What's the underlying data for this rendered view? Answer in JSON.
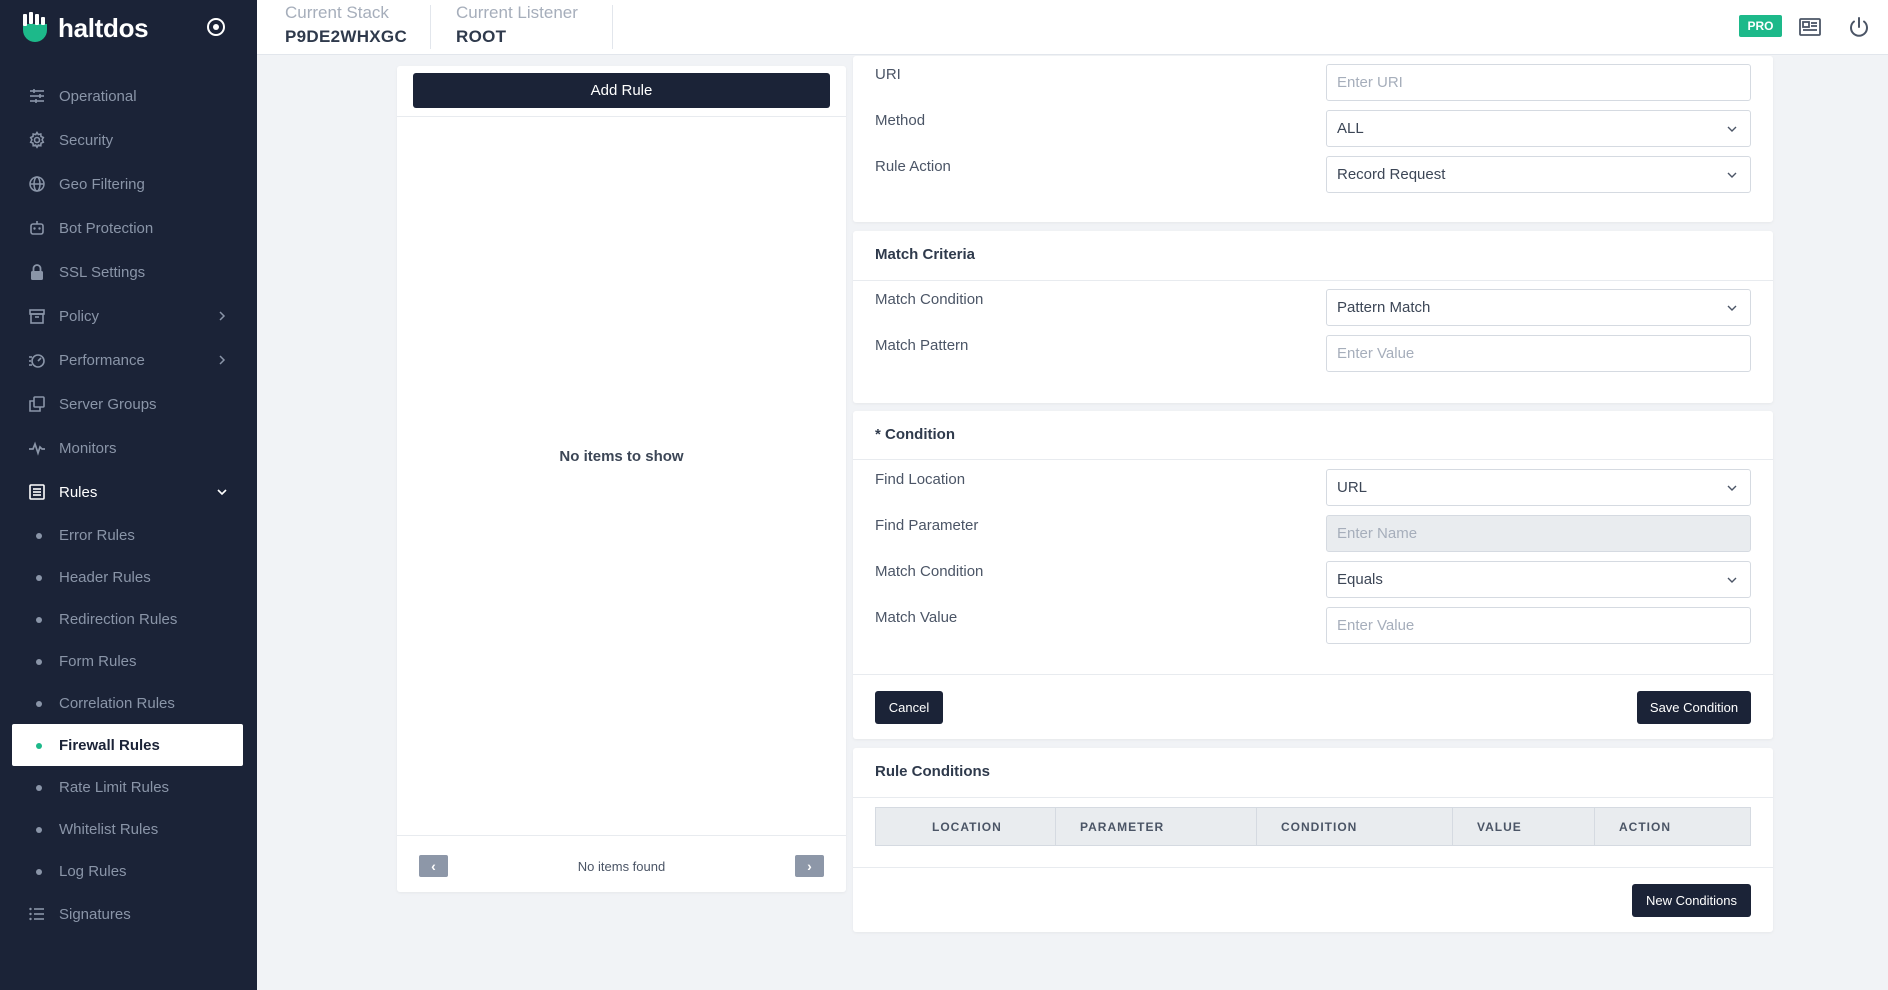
{
  "brand": {
    "name": "haltdos",
    "logo_icon": "haltdos-logo-icon",
    "toggle_icon": "target-circle-icon",
    "accent": "#1db98a"
  },
  "header": {
    "stack_label": "Current Stack",
    "stack_value": "P9DE2WHXGC",
    "listener_label": "Current Listener",
    "listener_value": "ROOT",
    "pro_badge": "PRO",
    "news_icon": "newspaper-icon",
    "power_icon": "power-icon"
  },
  "sidebar": {
    "items": [
      {
        "label": "Operational",
        "icon": "sliders-icon"
      },
      {
        "label": "Security",
        "icon": "gear-icon"
      },
      {
        "label": "Geo Filtering",
        "icon": "globe-icon"
      },
      {
        "label": "Bot Protection",
        "icon": "robot-icon"
      },
      {
        "label": "SSL Settings",
        "icon": "lock-icon"
      },
      {
        "label": "Policy",
        "icon": "archive-icon"
      },
      {
        "label": "Performance",
        "icon": "gauge-icon"
      },
      {
        "label": "Server Groups",
        "icon": "copy-icon"
      },
      {
        "label": "Monitors",
        "icon": "pulse-icon"
      },
      {
        "label": "Rules",
        "icon": "list-box-icon"
      }
    ],
    "rules_sub": [
      {
        "label": "Error Rules"
      },
      {
        "label": "Header Rules"
      },
      {
        "label": "Redirection Rules"
      },
      {
        "label": "Form Rules"
      },
      {
        "label": "Correlation Rules"
      },
      {
        "label": "Firewall Rules"
      },
      {
        "label": "Rate Limit Rules"
      },
      {
        "label": "Whitelist Rules"
      },
      {
        "label": "Log Rules"
      }
    ],
    "signatures": {
      "label": "Signatures",
      "icon": "list-icon"
    }
  },
  "rule_list": {
    "add_button": "Add Rule",
    "empty_message": "No items to show",
    "footer_text": "No items found",
    "prev": "‹",
    "next": "›"
  },
  "rule_form": {
    "uri_label": "URI",
    "uri_placeholder": "Enter URI",
    "method_label": "Method",
    "method_value": "ALL",
    "action_label": "Rule Action",
    "action_value": "Record Request"
  },
  "match_criteria": {
    "title": "Match Criteria",
    "condition_label": "Match Condition",
    "condition_value": "Pattern Match",
    "pattern_label": "Match Pattern",
    "pattern_placeholder": "Enter Value"
  },
  "condition": {
    "title": "* Condition",
    "find_location_label": "Find Location",
    "find_location_value": "URL",
    "find_parameter_label": "Find Parameter",
    "find_parameter_placeholder": "Enter Name",
    "match_condition_label": "Match Condition",
    "match_condition_value": "Equals",
    "match_value_label": "Match Value",
    "match_value_placeholder": "Enter Value",
    "cancel_button": "Cancel",
    "save_button": "Save Condition"
  },
  "rule_conditions": {
    "title": "Rule Conditions",
    "columns": [
      "LOCATION",
      "PARAMETER",
      "CONDITION",
      "VALUE",
      "ACTION"
    ],
    "new_button": "New Conditions"
  }
}
